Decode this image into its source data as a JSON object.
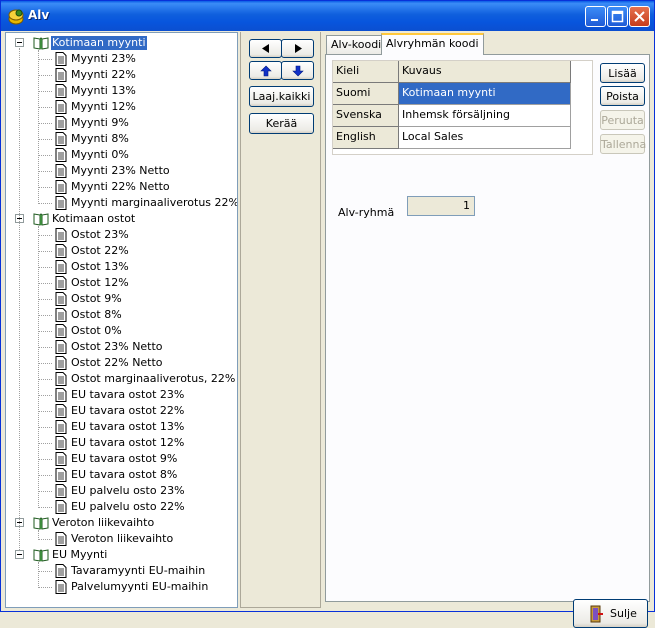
{
  "window": {
    "title": "Alv"
  },
  "tree": [
    {
      "label": "Kotimaan myynti",
      "kind": "group",
      "selected": true
    },
    {
      "label": "Myynti 23%",
      "kind": "leaf"
    },
    {
      "label": "Myynti 22%",
      "kind": "leaf"
    },
    {
      "label": "Myynti 13%",
      "kind": "leaf"
    },
    {
      "label": "Myynti 12%",
      "kind": "leaf"
    },
    {
      "label": "Myynti 9%",
      "kind": "leaf"
    },
    {
      "label": "Myynti 8%",
      "kind": "leaf"
    },
    {
      "label": "Myynti 0%",
      "kind": "leaf"
    },
    {
      "label": "Myynti 23% Netto",
      "kind": "leaf"
    },
    {
      "label": "Myynti 22% Netto",
      "kind": "leaf"
    },
    {
      "label": "Myynti marginaaliverotus 22%",
      "kind": "leaf"
    },
    {
      "label": "Kotimaan ostot",
      "kind": "group"
    },
    {
      "label": "Ostot 23%",
      "kind": "leaf"
    },
    {
      "label": "Ostot 22%",
      "kind": "leaf"
    },
    {
      "label": "Ostot 13%",
      "kind": "leaf"
    },
    {
      "label": "Ostot 12%",
      "kind": "leaf"
    },
    {
      "label": "Ostot 9%",
      "kind": "leaf"
    },
    {
      "label": "Ostot 8%",
      "kind": "leaf"
    },
    {
      "label": "Ostot 0%",
      "kind": "leaf"
    },
    {
      "label": "Ostot 23%  Netto",
      "kind": "leaf"
    },
    {
      "label": "Ostot 22%  Netto",
      "kind": "leaf"
    },
    {
      "label": "Ostot marginaaliverotus, 22%",
      "kind": "leaf"
    },
    {
      "label": "EU tavara ostot 23%",
      "kind": "leaf"
    },
    {
      "label": "EU tavara ostot 22%",
      "kind": "leaf"
    },
    {
      "label": "EU tavara ostot 13%",
      "kind": "leaf"
    },
    {
      "label": "EU tavara ostot 12%",
      "kind": "leaf"
    },
    {
      "label": "EU tavara ostot 9%",
      "kind": "leaf"
    },
    {
      "label": "EU tavara ostot 8%",
      "kind": "leaf"
    },
    {
      "label": "EU palvelu osto 23%",
      "kind": "leaf"
    },
    {
      "label": "EU palvelu osto 22%",
      "kind": "leaf"
    },
    {
      "label": "Veroton liikevaihto",
      "kind": "group"
    },
    {
      "label": "Veroton liikevaihto",
      "kind": "leaf"
    },
    {
      "label": "EU Myynti",
      "kind": "group"
    },
    {
      "label": "Tavaramyynti EU-maihin",
      "kind": "leaf"
    },
    {
      "label": "Palvelumyynti EU-maihin",
      "kind": "leaf"
    }
  ],
  "middle": {
    "expand_all_label": "Laaj.kaikki",
    "collect_label": "Kerää"
  },
  "tabs": [
    {
      "label": "Alv-koodi",
      "active": false
    },
    {
      "label": "Alvryhmän koodi",
      "active": true
    }
  ],
  "grid": {
    "headers": [
      "Kieli",
      "Kuvaus"
    ],
    "rows": [
      {
        "lang": "Suomi",
        "desc": "Kotimaan myynti",
        "selected": true
      },
      {
        "lang": "Svenska",
        "desc": "Inhemsk försäljning"
      },
      {
        "lang": "English",
        "desc": "Local Sales"
      }
    ]
  },
  "side_buttons": {
    "add": "Lisää",
    "remove": "Poista",
    "cancel": "Peruuta",
    "save": "Tallenna"
  },
  "group_field": {
    "label": "Alv-ryhmä",
    "value": "1"
  },
  "close_button": {
    "label": "Sulje"
  },
  "colors": {
    "selection": "#316ac5",
    "titlebar": "#0855dd",
    "face": "#ece9d8"
  }
}
